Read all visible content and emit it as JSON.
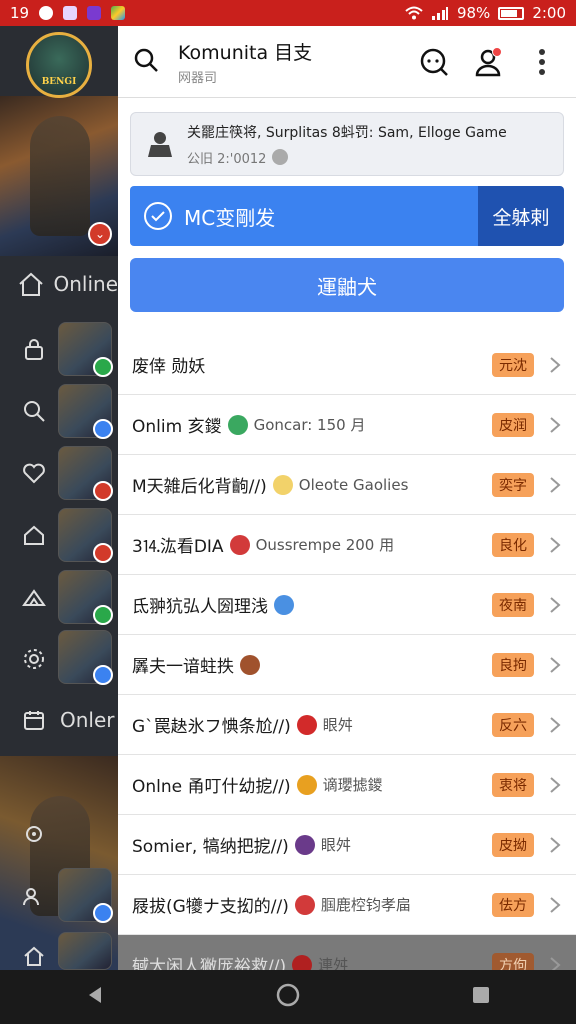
{
  "status_bar": {
    "time": "19",
    "battery": "98%",
    "clock": "2:00",
    "icons": [
      "notification-icon",
      "wifi-icon",
      "signal-icon",
      "battery-icon"
    ]
  },
  "sidebar": {
    "avatar_label": "BENGI",
    "items": [
      {
        "label": "Online",
        "icon": "home-icon"
      },
      {
        "label": "",
        "icon": "lock-icon"
      },
      {
        "label": "",
        "icon": "search-icon"
      },
      {
        "label": "",
        "icon": "heart-icon"
      },
      {
        "label": "",
        "icon": "house-icon"
      },
      {
        "label": "",
        "icon": "tent-icon"
      },
      {
        "label": "",
        "icon": "gear-icon"
      },
      {
        "label": "Onler",
        "icon": "calendar-icon"
      }
    ],
    "thumb_badges": [
      "#2aa84a",
      "#3b82f0",
      "#d23a2a",
      "#d23a2a",
      "#2aa84a",
      "#3b82f0",
      "#3b82f0"
    ]
  },
  "header": {
    "title": "Komunita 目支",
    "subtitle": "网器司"
  },
  "info": {
    "line1": "关罷庄筷将, Surplitas 8蚪罚: Sam, Elloge Game",
    "line2": "公旧 2:'0012"
  },
  "banner": {
    "label": "MC变剛发",
    "action": "全躰剌"
  },
  "primary_button": "運鼬犬",
  "list": [
    {
      "text": "废倖  勋妖",
      "sub": "",
      "tag": "元沈",
      "emoji": ""
    },
    {
      "text": "Onlim 亥鑁",
      "sub": "Goncar: 150 月",
      "tag": "皮润",
      "emoji": "#3aa860"
    },
    {
      "text": "M天雑后化背齣//)",
      "sub": "Oleote Gaolies",
      "tag": "奕字",
      "emoji": "#f2d26a"
    },
    {
      "text": "3⒕汯看DIA",
      "sub": "Oussrempe 200 用",
      "tag": "良化",
      "emoji": "#d23a3a"
    },
    {
      "text": "氐翀犺弘人圀理浅",
      "sub": "",
      "tag": "夜南",
      "emoji": "#4a90e2"
    },
    {
      "text": "羼夫一谙蛀抶",
      "sub": "",
      "tag": "良拘",
      "emoji": "#a0522d"
    },
    {
      "text": "G`罠赽氷フ㥏条尬//)",
      "sub": "眼舛",
      "tag": "反六",
      "emoji": "#d22a2a"
    },
    {
      "text": "Onlne 甬叮什幼㧖//)",
      "sub": "谪瓔摅鑁",
      "tag": "衷将",
      "emoji": "#e8a020"
    },
    {
      "text": "Somier, 犒纳把㧖//)",
      "sub": "眼舛",
      "tag": "皮拗",
      "emoji": "#6a3a8a"
    },
    {
      "text": "屐拔(G犪ナ支抝的//)",
      "sub": "腘鹿椌钧孝㧂",
      "tag": "佉方",
      "emoji": "#d23a3a"
    },
    {
      "text": "戫大闲人獙厐裕救//)",
      "sub": "連舛",
      "tag": "方佝",
      "emoji": "#b02020"
    }
  ]
}
